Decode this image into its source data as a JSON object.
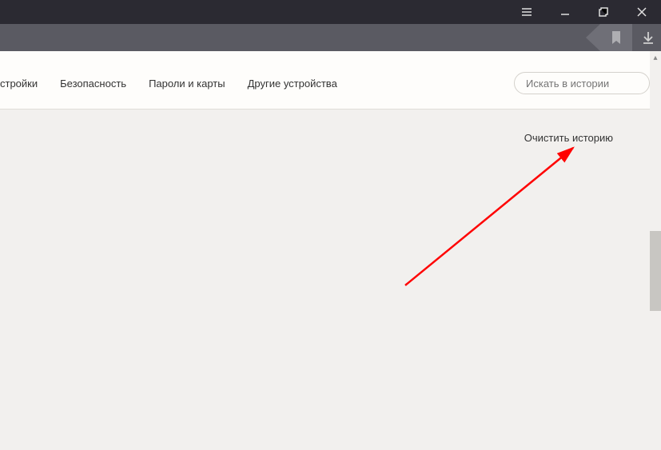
{
  "tabs": {
    "settings": "стройки",
    "security": "Безопасность",
    "passwords": "Пароли и карты",
    "devices": "Другие устройства"
  },
  "search": {
    "placeholder": "Искать в истории"
  },
  "actions": {
    "clear_history": "Очистить историю"
  }
}
